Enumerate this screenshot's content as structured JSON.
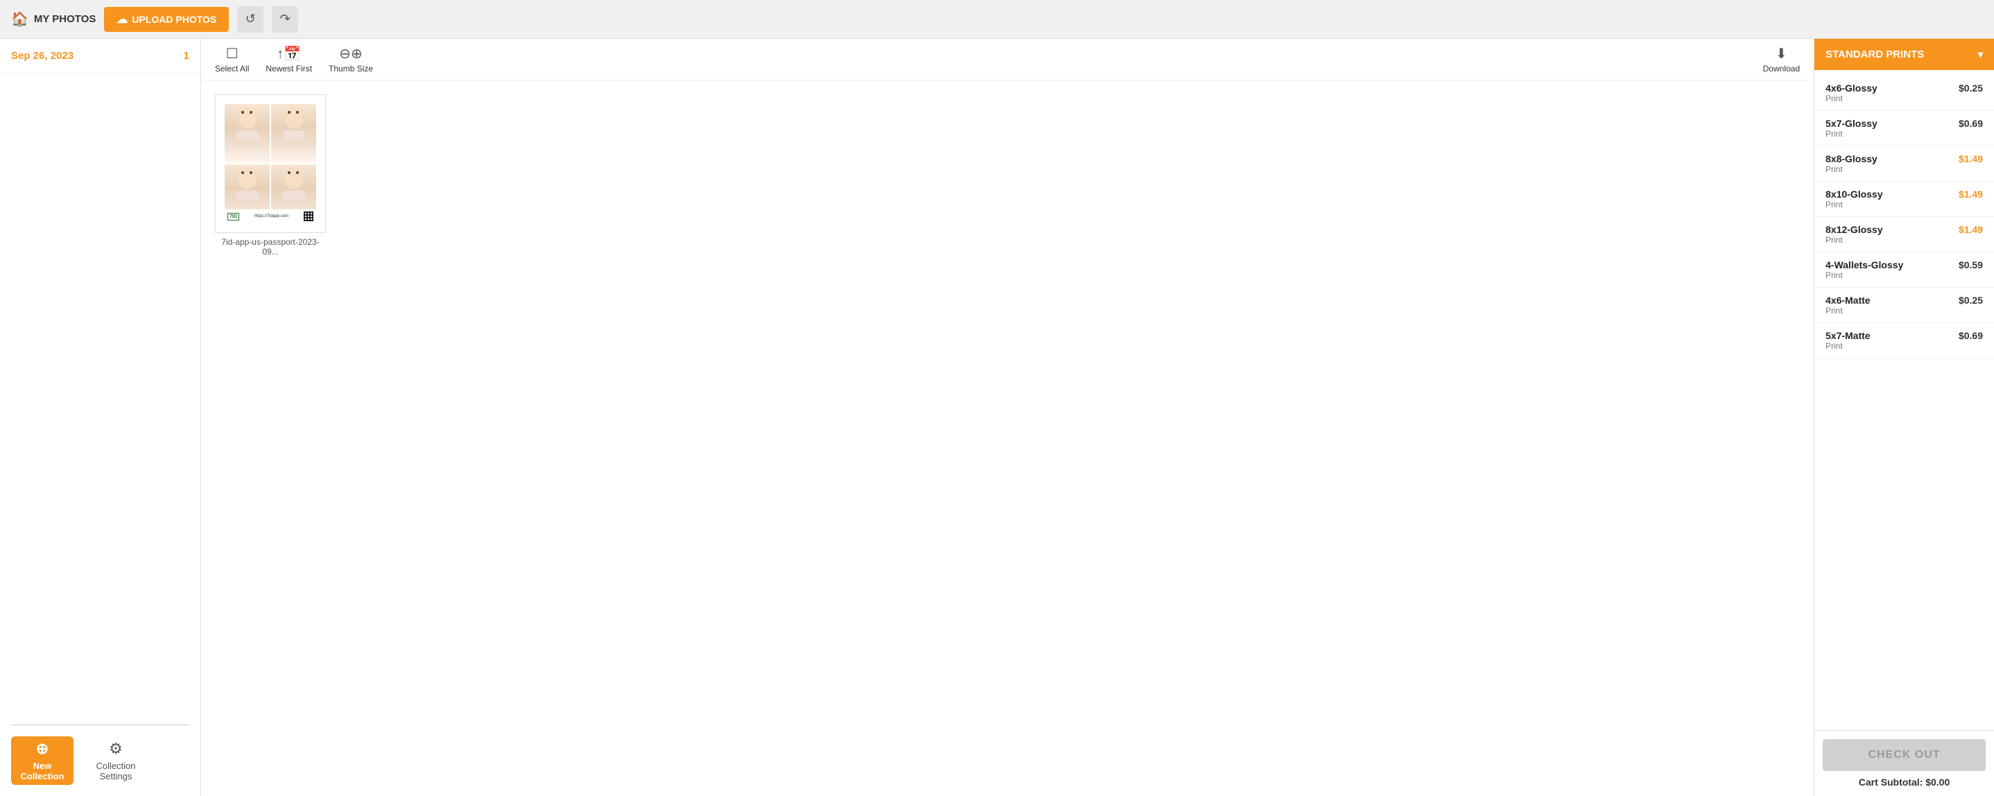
{
  "topbar": {
    "my_photos_label": "MY PHOTOS",
    "upload_btn_label": "UPLOAD PHOTOS",
    "refresh_icon": "↺",
    "share_icon": "↷"
  },
  "sidebar": {
    "date_label": "Sep 26, 2023",
    "date_count": "1",
    "new_collection_label": "New Collection",
    "collection_settings_label": "Collection Settings"
  },
  "toolbar": {
    "select_all_label": "Select All",
    "newest_first_label": "Newest First",
    "thumb_size_label": "Thumb Size",
    "download_label": "Download"
  },
  "photo": {
    "filename": "7id-app-us-passport-2023-09..."
  },
  "right_panel": {
    "standard_prints_label": "STANDARD PRINTS",
    "prints": [
      {
        "name": "4x6-Glossy",
        "type": "Print",
        "price": "$0.25",
        "highlight": false
      },
      {
        "name": "5x7-Glossy",
        "type": "Print",
        "price": "$0.69",
        "highlight": false
      },
      {
        "name": "8x8-Glossy",
        "type": "Print",
        "price": "$1.49",
        "highlight": true
      },
      {
        "name": "8x10-Glossy",
        "type": "Print",
        "price": "$1.49",
        "highlight": true
      },
      {
        "name": "8x12-Glossy",
        "type": "Print",
        "price": "$1.49",
        "highlight": true
      },
      {
        "name": "4-Wallets-Glossy",
        "type": "Print",
        "price": "$0.59",
        "highlight": false
      },
      {
        "name": "4x6-Matte",
        "type": "Print",
        "price": "$0.25",
        "highlight": false
      },
      {
        "name": "5x7-Matte",
        "type": "Print",
        "price": "$0.69",
        "highlight": false
      }
    ],
    "checkout_label": "CHECK OUT",
    "cart_subtotal_label": "Cart Subtotal: $0.00"
  }
}
